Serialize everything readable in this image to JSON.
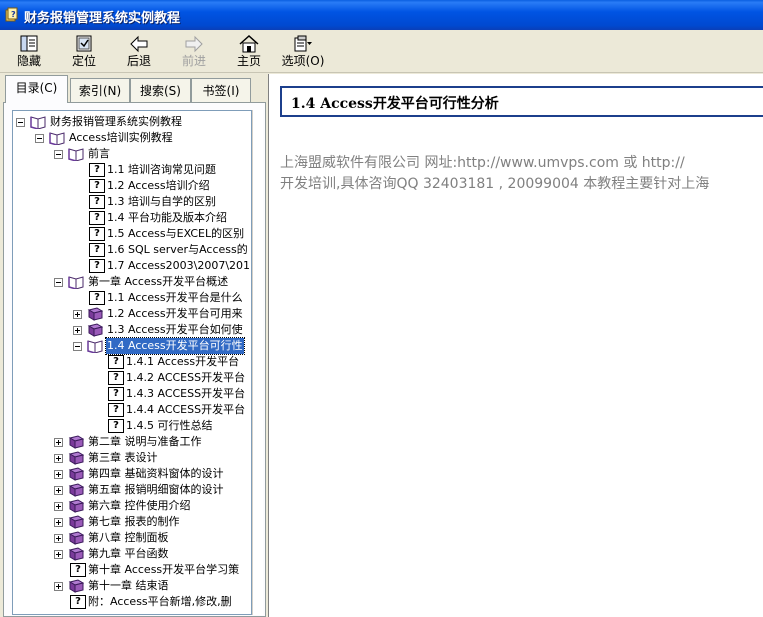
{
  "window": {
    "title": "财务报销管理系统实例教程",
    "icon": "help-book-icon"
  },
  "toolbar": {
    "buttons": [
      {
        "label": "隐藏",
        "icon": "hide-pane-icon",
        "enabled": true
      },
      {
        "label": "定位",
        "icon": "locate-icon",
        "enabled": true
      },
      {
        "label": "后退",
        "icon": "back-arrow-icon",
        "enabled": true
      },
      {
        "label": "前进",
        "icon": "forward-arrow-icon",
        "enabled": false
      },
      {
        "label": "主页",
        "icon": "home-icon",
        "enabled": true
      },
      {
        "label": "选项(O)",
        "icon": "options-icon",
        "enabled": true
      }
    ]
  },
  "tabs": [
    {
      "label": "目录(C)",
      "active": true
    },
    {
      "label": "索引(N)",
      "active": false
    },
    {
      "label": "搜索(S)",
      "active": false
    },
    {
      "label": "书签(I)",
      "active": false
    }
  ],
  "tree": [
    {
      "label": "财务报销管理系统实例教程",
      "type": "book-open",
      "expander": "minus"
    },
    {
      "label": "Access培训实例教程",
      "type": "book-open",
      "expander": "minus"
    },
    {
      "label": "前言",
      "type": "book-open",
      "expander": "minus"
    },
    {
      "label": "1.1 培训咨询常见问题",
      "type": "page"
    },
    {
      "label": "1.2 Access培训介绍",
      "type": "page"
    },
    {
      "label": "1.3 培训与自学的区别",
      "type": "page"
    },
    {
      "label": "1.4 平台功能及版本介绍",
      "type": "page"
    },
    {
      "label": "1.5 Access与EXCEL的区别",
      "type": "page"
    },
    {
      "label": "1.6 SQL server与Access的",
      "type": "page"
    },
    {
      "label": "1.7 Access2003\\2007\\201",
      "type": "page"
    },
    {
      "label": "第一章 Access开发平台概述",
      "type": "book-open",
      "expander": "minus"
    },
    {
      "label": "1.1 Access开发平台是什么",
      "type": "page"
    },
    {
      "label": "1.2 Access开发平台可用来",
      "type": "book-closed",
      "expander": "plus"
    },
    {
      "label": "1.3 Access开发平台如何使",
      "type": "book-closed",
      "expander": "plus"
    },
    {
      "label": "1.4 Access开发平台可行性",
      "type": "book-open",
      "expander": "minus",
      "selected": true
    },
    {
      "label": "1.4.1 Access开发平台",
      "type": "page"
    },
    {
      "label": "1.4.2 ACCESS开发平台",
      "type": "page"
    },
    {
      "label": "1.4.3 ACCESS开发平台",
      "type": "page"
    },
    {
      "label": "1.4.4 ACCESS开发平台",
      "type": "page"
    },
    {
      "label": "1.4.5 可行性总结",
      "type": "page"
    },
    {
      "label": "第二章 说明与准备工作",
      "type": "book-closed",
      "expander": "plus"
    },
    {
      "label": "第三章 表设计",
      "type": "book-closed",
      "expander": "plus"
    },
    {
      "label": "第四章 基础资料窗体的设计",
      "type": "book-closed",
      "expander": "plus"
    },
    {
      "label": "第五章 报销明细窗体的设计",
      "type": "book-closed",
      "expander": "plus"
    },
    {
      "label": "第六章 控件使用介绍",
      "type": "book-closed",
      "expander": "plus"
    },
    {
      "label": "第七章 报表的制作",
      "type": "book-closed",
      "expander": "plus"
    },
    {
      "label": "第八章 控制面板",
      "type": "book-closed",
      "expander": "plus"
    },
    {
      "label": "第九章 平台函数",
      "type": "book-closed",
      "expander": "plus"
    },
    {
      "label": "第十章 Access开发平台学习策",
      "type": "page"
    },
    {
      "label": "第十一章 结束语",
      "type": "book-closed",
      "expander": "plus"
    },
    {
      "label": "附：Access平台新增,修改,删",
      "type": "page"
    }
  ],
  "content": {
    "title": "1.4 Access开发平台可行性分析",
    "paragraph_lines": [
      "上海盟威软件有限公司 网址:http://www.umvps.com 或 http://",
      "开发培训,具体咨询QQ 32403181 , 20099004 本教程主要针对上海"
    ]
  }
}
